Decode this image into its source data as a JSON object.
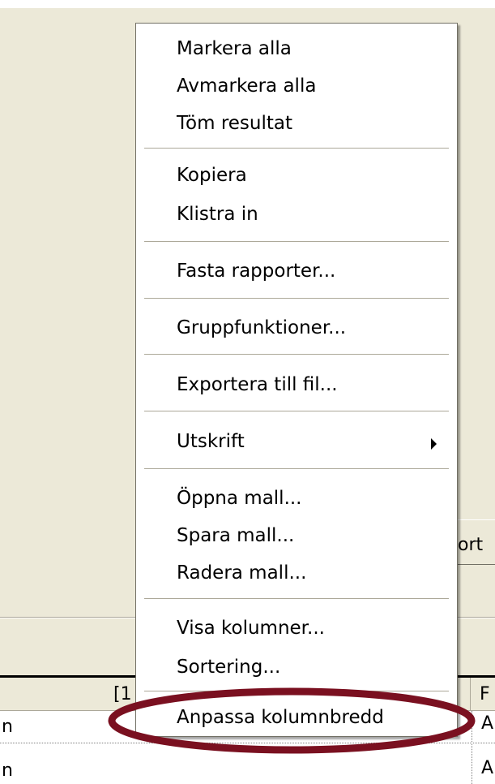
{
  "background": {
    "button_partial_label": "ort",
    "grid": {
      "header_partial_1": "[1",
      "header_partial_2": "F",
      "rows": [
        {
          "col1": "n",
          "col2": "A"
        },
        {
          "col1": "n",
          "col2": "A"
        }
      ]
    }
  },
  "context_menu": {
    "items": [
      {
        "label": "Markera alla"
      },
      {
        "label": "Avmarkera alla"
      },
      {
        "label": "Töm resultat"
      },
      {
        "label": "Kopiera"
      },
      {
        "label": "Klistra in"
      },
      {
        "label": "Fasta rapporter..."
      },
      {
        "label": "Gruppfunktioner..."
      },
      {
        "label": "Exportera till fil..."
      },
      {
        "label": "Utskrift",
        "submenu": true
      },
      {
        "label": "Öppna mall..."
      },
      {
        "label": "Spara mall..."
      },
      {
        "label": "Radera mall..."
      },
      {
        "label": "Visa kolumner..."
      },
      {
        "label": "Sortering..."
      },
      {
        "label": "Anpassa kolumnbredd",
        "circled": true
      }
    ]
  },
  "colors": {
    "annotation_ellipse": "#7a1020",
    "menu_background": "#ffffff",
    "window_background": "#ece9d8"
  }
}
